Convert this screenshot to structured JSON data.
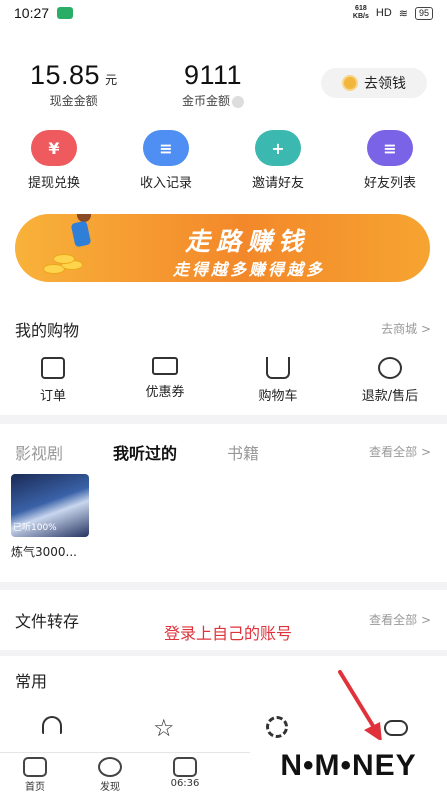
{
  "status_bar": {
    "time": "10:27",
    "speed": "618\nKB/s",
    "signal": "HD",
    "battery": "95"
  },
  "stats": {
    "cash": {
      "value": "15.85",
      "unit": "元",
      "label": "现金金额"
    },
    "coins": {
      "value": "9111",
      "label": "金币金额"
    },
    "earn_button": "去领钱"
  },
  "quick_actions": [
    {
      "label": "提现兑换",
      "icon": "yuan-coin-icon",
      "color": "#ef5a5f",
      "glyph": "¥"
    },
    {
      "label": "收入记录",
      "icon": "record-list-icon",
      "color": "#4f8ef2",
      "glyph": "≡"
    },
    {
      "label": "邀请好友",
      "icon": "invite-friend-icon",
      "color": "#3bb8b0",
      "glyph": "+"
    },
    {
      "label": "好友列表",
      "icon": "friend-list-icon",
      "color": "#7a63e6",
      "glyph": "≡"
    }
  ],
  "banner": {
    "line1": "走路赚钱",
    "line2": "走得越多赚得越多"
  },
  "shopping": {
    "title": "我的购物",
    "link": "去商城 >",
    "items": [
      {
        "label": "订单",
        "icon": "order-icon"
      },
      {
        "label": "优惠券",
        "icon": "coupon-icon"
      },
      {
        "label": "购物车",
        "icon": "cart-icon"
      },
      {
        "label": "退款/售后",
        "icon": "refund-icon"
      }
    ]
  },
  "media": {
    "tabs": [
      "影视剧",
      "我听过的",
      "书籍"
    ],
    "active_tab": "我听过的",
    "link": "查看全部 >",
    "item": {
      "title": "炼气3000...",
      "caption": "已听100%"
    }
  },
  "files": {
    "title": "文件转存",
    "link": "查看全部 >"
  },
  "annotation": "登录上自己的账号",
  "common": {
    "title": "常用"
  },
  "bottom_nav": [
    {
      "label": "首页",
      "icon": "home-icon"
    },
    {
      "label": "发现",
      "icon": "compass-icon"
    },
    {
      "label": "06:36",
      "icon": "calendar-check-icon"
    }
  ],
  "watermark": "N•M•NEY"
}
